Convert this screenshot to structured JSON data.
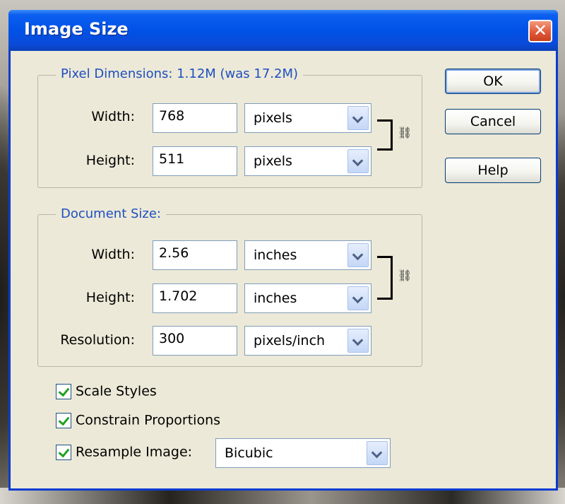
{
  "window": {
    "title": "Image Size",
    "close_glyph": "✕"
  },
  "pixel_dimensions": {
    "legend": "Pixel Dimensions:  1.12M (was 17.2M)",
    "width": {
      "label": "Width:",
      "value": "768",
      "unit": "pixels"
    },
    "height": {
      "label": "Height:",
      "value": "511",
      "unit": "pixels"
    }
  },
  "document_size": {
    "legend": "Document Size:",
    "width": {
      "label": "Width:",
      "value": "2.56",
      "unit": "inches"
    },
    "height": {
      "label": "Height:",
      "value": "1.702",
      "unit": "inches"
    },
    "resolution": {
      "label": "Resolution:",
      "value": "300",
      "unit": "pixels/inch"
    }
  },
  "buttons": {
    "ok": "OK",
    "cancel": "Cancel",
    "help": "Help"
  },
  "options": {
    "scale_styles": {
      "label": "Scale Styles",
      "checked": true
    },
    "constrain_proportions": {
      "label": "Constrain Proportions",
      "checked": true
    },
    "resample_image": {
      "label": "Resample Image:",
      "checked": true,
      "method": "Bicubic"
    }
  },
  "icons": {
    "link": "chain-link-icon",
    "checkmark": "checkmark-icon",
    "dropdown": "chevron-down-icon"
  },
  "colors": {
    "title_bar": "#0052e6",
    "close_button": "#e1593b",
    "legend_text": "#1f4fbf",
    "check": "#21a121"
  }
}
